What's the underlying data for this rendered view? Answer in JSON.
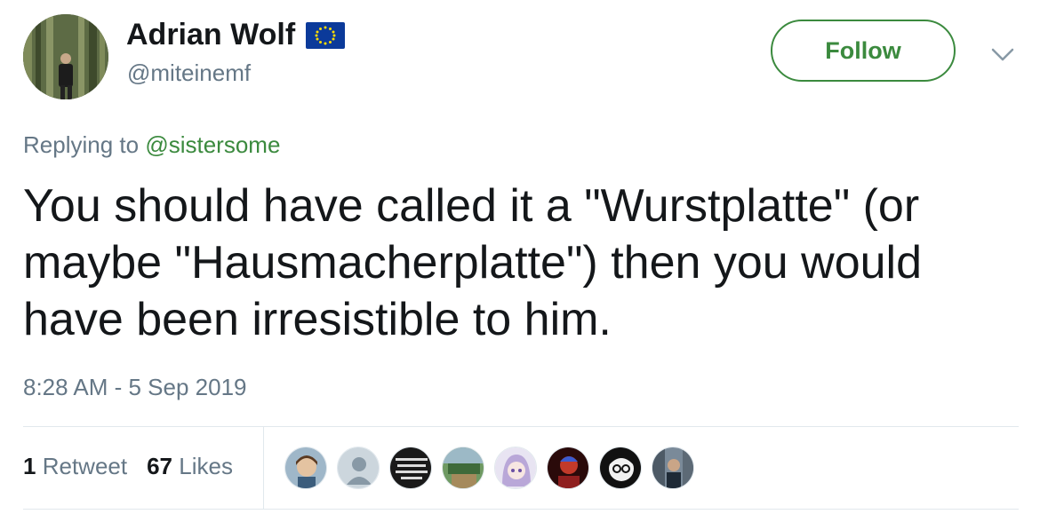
{
  "author": {
    "name": "Adrian Wolf",
    "handle": "@miteinemf",
    "badge_icon": "eu-flag-icon"
  },
  "follow_label": "Follow",
  "reply": {
    "prefix": "Replying to ",
    "mention": "@sistersome"
  },
  "tweet_text": "You should have called it a \"Wurstplatte\" (or maybe \"Hausmacherplatte\") then you would have been irresistible to him.",
  "timestamp": "8:28 AM - 5 Sep 2019",
  "stats": {
    "retweets_count": "1",
    "retweets_label": "Retweet",
    "likes_count": "67",
    "likes_label": "Likes"
  },
  "colors": {
    "accent": "#3b8a3e",
    "secondary_text": "#657786",
    "divider": "#e1e8ed",
    "eu_blue": "#0b3a9a",
    "eu_star": "#ffdd00"
  },
  "likers": [
    "liker-avatar-cartoon",
    "liker-avatar-default",
    "liker-avatar-text-sign",
    "liker-avatar-field",
    "liker-avatar-anime",
    "liker-avatar-red",
    "liker-avatar-glasses",
    "liker-avatar-street"
  ]
}
